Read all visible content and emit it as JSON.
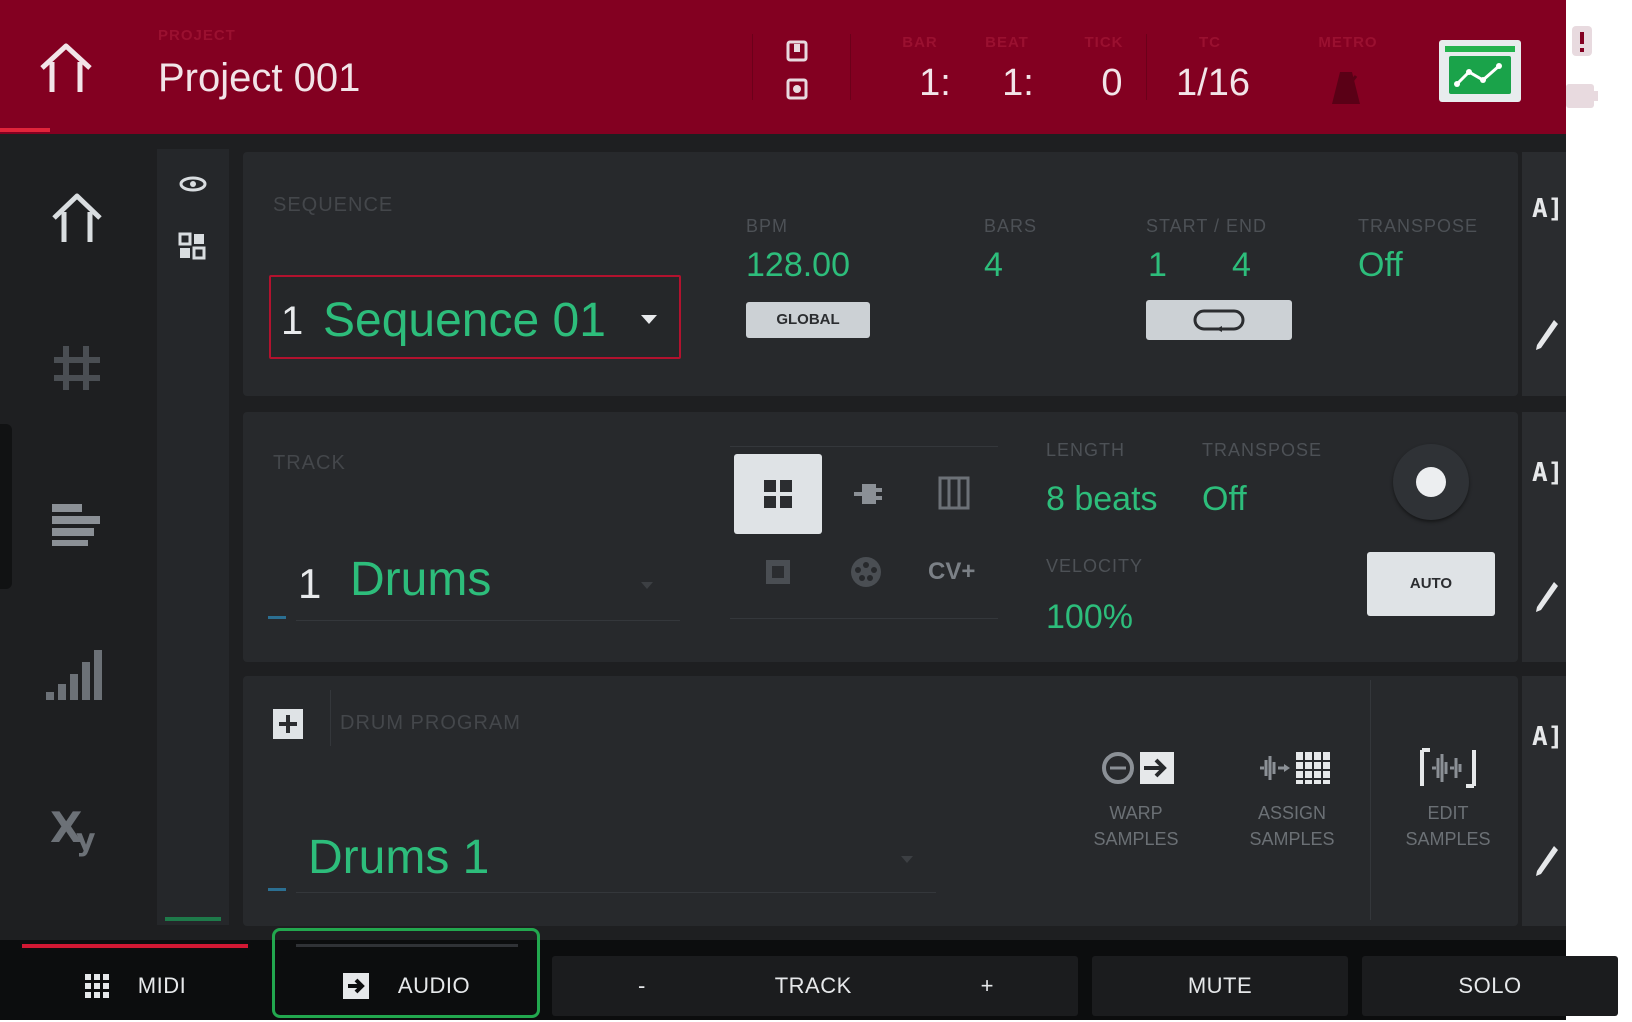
{
  "header": {
    "project_label": "PROJECT",
    "project_name": "Project 001",
    "transport": [
      {
        "label": "BAR",
        "value": "1:"
      },
      {
        "label": "BEAT",
        "value": "1:"
      },
      {
        "label": "TICK",
        "value": "0"
      },
      {
        "label": "TC",
        "value": "1/16"
      },
      {
        "label": "METRO",
        "value": ""
      }
    ]
  },
  "sequence_panel": {
    "label": "SEQUENCE",
    "number": "1",
    "name": "Sequence 01",
    "bpm_label": "BPM",
    "bpm": "128.00",
    "global_button": "GLOBAL",
    "bars_label": "BARS",
    "bars": "4",
    "start_end_label": "START / END",
    "start": "1",
    "end": "4",
    "transpose_label": "TRANSPOSE",
    "transpose": "Off"
  },
  "track_panel": {
    "label": "TRACK",
    "number": "1",
    "name": "Drums",
    "cv_label": "CV+",
    "length_label": "LENGTH",
    "length": "8 beats",
    "transpose_label": "TRANSPOSE",
    "transpose": "Off",
    "velocity_label": "VELOCITY",
    "velocity": "100%",
    "auto_button": "AUTO"
  },
  "program_panel": {
    "label": "DRUM PROGRAM",
    "name": "Drums 1",
    "tools": [
      {
        "line1": "WARP",
        "line2": "SAMPLES"
      },
      {
        "line1": "ASSIGN",
        "line2": "SAMPLES"
      },
      {
        "line1": "EDIT",
        "line2": "SAMPLES"
      }
    ]
  },
  "side_tools": {
    "a_label": "A]"
  },
  "bottom_bar": {
    "midi": "MIDI",
    "audio": "AUDIO",
    "minus": "-",
    "track": "TRACK",
    "plus": "+",
    "mute": "MUTE",
    "solo": "SOLO"
  },
  "colors": {
    "header": "#830021",
    "accent_green": "#2dbd7b",
    "highlight_red": "#b2122e",
    "outline_green": "#22a74e"
  }
}
